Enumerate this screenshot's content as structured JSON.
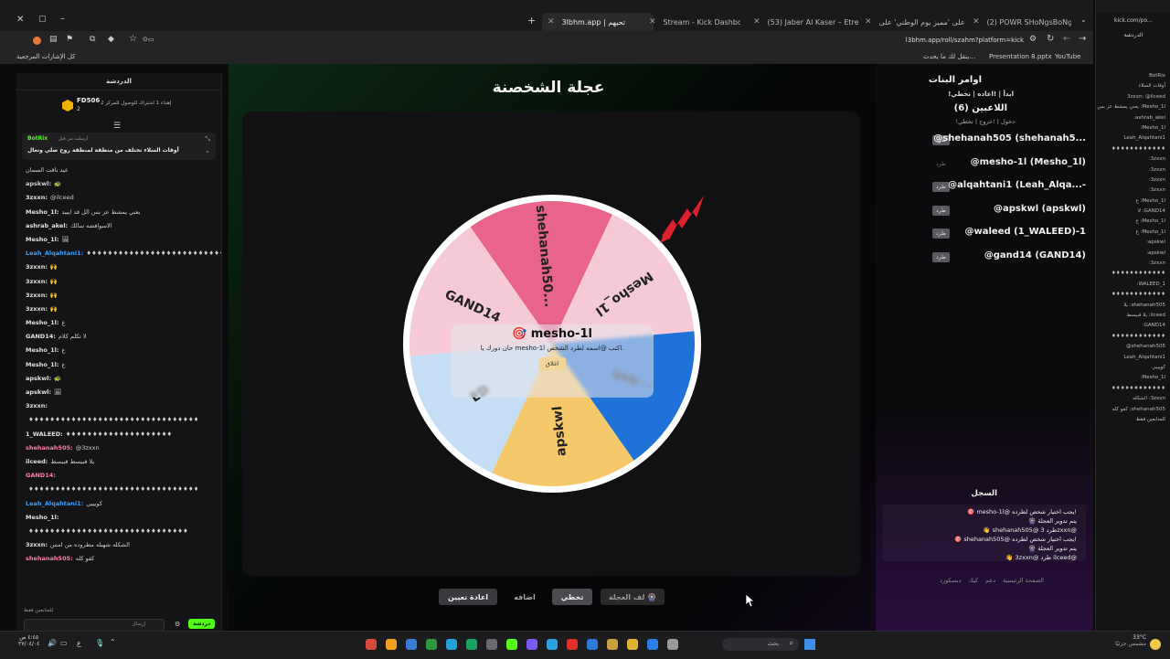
{
  "browser": {
    "tabs": [
      {
        "title": "ا3bhm.app | تحيهم",
        "active": true
      },
      {
        "title": "Stream - Kick Dashboard"
      },
      {
        "title": "(53) Jaber Al Kaser – Etreb Ya !"
      },
      {
        "title": "انظر على 'مميز يوم الوطني' على…"
      },
      {
        "title": "(2) POWR SHoNgsBoNg (@SH…"
      }
    ],
    "new_tab_symbol": "+",
    "address": "l3bhm.app/roll/szahm?platform=kick",
    "bookmarks": {
      "all_bookmarks": "كل الإشارات المرجعية",
      "youtube": "YouTube",
      "presentation": "Presentation 8.pptx",
      "x_item": "ينقل لك ما يحدث…"
    }
  },
  "left_chat": {
    "header": "الدردشة",
    "pinned_user": "FD506",
    "pinned_rank": "2",
    "pinned_note": "إهداء 1 اشتراك للوصول للمركز 2",
    "bot_name": "BotRix",
    "bot_pinned_by": "أرسلت من قبل",
    "bot_message": "أوقات السلاء تختلف من منطقة لمنطقة روح صلي وتعال",
    "messages": [
      {
        "user": "",
        "text": "عيد باقت السمان",
        "color": "#c9c9c9"
      },
      {
        "user": "apskwl:",
        "text": "🐢",
        "color": "#d0d0d0"
      },
      {
        "user": "3zxxn:",
        "text": "@ilceed",
        "color": "#e0e0e0"
      },
      {
        "user": "Mesho_1l:",
        "text": "يعني يمشط عز بس الل قد ايبيد",
        "color": "#e0e0e0"
      },
      {
        "user": "ashrab_akel:",
        "text": "الاسوافضه سالك",
        "color": "#e0e0e0"
      },
      {
        "user": "Mesho_1l:",
        "text": "🖼",
        "color": "#e0e0e0"
      },
      {
        "user": "Leah_Alqahtani1:",
        "text": "♦♦♦♦♦♦♦♦♦♦♦♦♦♦♦♦♦♦♦♦♦♦♦♦♦♦",
        "color": "#3aa0ff"
      },
      {
        "user": "3zxxn:",
        "text": "🙌",
        "color": "#e0e0e0"
      },
      {
        "user": "3zxxn:",
        "text": "🙌",
        "color": "#e0e0e0"
      },
      {
        "user": "3zxxn:",
        "text": "🙌",
        "color": "#e0e0e0"
      },
      {
        "user": "3zxxn:",
        "text": "🙌",
        "color": "#e0e0e0"
      },
      {
        "user": "Mesho_1l:",
        "text": "ع",
        "color": "#e0e0e0"
      },
      {
        "user": "GAND14:",
        "text": "لا تكلم كلام",
        "color": "#e0e0e0"
      },
      {
        "user": "Mesho_1l:",
        "text": "ع",
        "color": "#e0e0e0"
      },
      {
        "user": "Mesho_1l:",
        "text": "ع",
        "color": "#e0e0e0"
      },
      {
        "user": "apskwl:",
        "text": "🐢",
        "color": "#e0e0e0"
      },
      {
        "user": "apskwl:",
        "text": "🖼",
        "color": "#e0e0e0"
      },
      {
        "user": "3zxxn:",
        "text": "",
        "color": "#e0e0e0"
      },
      {
        "user": "",
        "text": "♦♦♦♦♦♦♦♦♦♦♦♦♦♦♦♦♦♦♦♦♦♦♦♦♦♦♦♦♦♦♦♦",
        "color": "#e0e0e0"
      },
      {
        "user": "1_WALEED:",
        "text": "♦♦♦♦♦♦♦♦♦♦♦♦♦♦♦♦♦♦♦♦",
        "color": "#e0e0e0"
      },
      {
        "user": "shehanah505:",
        "text": "@3zxxn",
        "color": "#ff7aa8"
      },
      {
        "user": "ilceed:",
        "text": "يلا قبيسط قبيسط",
        "color": "#e0e0e0"
      },
      {
        "user": "GAND14:",
        "text": "",
        "color": "#ff7aa8"
      },
      {
        "user": "",
        "text": "♦♦♦♦♦♦♦♦♦♦♦♦♦♦♦♦♦♦♦♦♦♦♦♦♦♦♦♦♦♦♦♦",
        "color": "#e0e0e0"
      },
      {
        "user": "Leah_Alqahtani1:",
        "text": "كويييي",
        "color": "#3aa0ff"
      },
      {
        "user": "Mesho_1l:",
        "text": "",
        "color": "#e0e0e0"
      },
      {
        "user": "",
        "text": "♦♦♦♦♦♦♦♦♦♦♦♦♦♦♦♦♦♦♦♦♦♦♦♦♦♦♦♦♦♦",
        "color": "#e0e0e0"
      },
      {
        "user": "3zxxn:",
        "text": "الشكله شهبله مطروده من امس",
        "color": "#e0e0e0"
      },
      {
        "user": "shehanah505:",
        "text": "كفو كله",
        "color": "#ff7aa8"
      }
    ],
    "followers_only": "للمتابعين فقط",
    "input_placeholder": "إرسال",
    "chat_button": "دردشة"
  },
  "main": {
    "title": "عجلة الشخصنة",
    "wheel_segments": [
      {
        "label": "shehanah50...",
        "color": "#e8648a"
      },
      {
        "label": "Mesho_1l",
        "color": "#f6c9d6"
      },
      {
        "label": "...qah",
        "color": "#1e72d8"
      },
      {
        "label": "apskwl",
        "color": "#f5c86a"
      },
      {
        "label": "ED",
        "color": "#c6def5"
      },
      {
        "label": "GAND14",
        "color": "#f6c9d6"
      }
    ],
    "popup": {
      "name": "🎯 mesho-1l",
      "message": "حان دورك يا mesho-1l اكتب @اسمه لطرد الشخص.",
      "close": "اغلاق"
    },
    "buttons": {
      "reset": "اعادة تعيين",
      "add": "اضافه",
      "skip": "تخطي",
      "spin": "لف العجلة 🎡"
    }
  },
  "commands": {
    "title": "اوامر البنات",
    "cmd_line": "!ابدأ | !اعاده | تخطي",
    "players_title": "اللاعبين (6)",
    "join_line": "!دخول | !خروج | تخطي",
    "kick_label": "طرد",
    "players": [
      {
        "name": "@shehanah505 (shehanah5...",
        "kick_active": true
      },
      {
        "name": "@mesho-1l (Mesho_1l)",
        "kick_active": false
      },
      {
        "name": "@alqahtani1 (Leah_Alqa...-",
        "kick_active": true
      },
      {
        "name": "@apskwl (apskwl)",
        "kick_active": true
      },
      {
        "name": "@waleed (1_WALEED)-1",
        "kick_active": true
      },
      {
        "name": "@gand14 (GAND14)",
        "kick_active": true
      }
    ],
    "log_title": "السجل",
    "log": [
      "🎯 mesho-1l@ يجب اختيار شخص لطرده!",
      "🎡 يتم تدوير العجلة",
      "👋 shehanah505@ طرد 3zxxn@",
      "🎯 shehanah505@ يجب اختيار شخص لطرده!",
      "🎡 يتم تدوير العجلة",
      "👋 3zxxn@ طرد ilceed@"
    ],
    "footer_links": [
      "الصفحة الرئيسية",
      "دعم",
      "كيك",
      "ديسكورد"
    ]
  },
  "right_panel": {
    "url": "kick.com/po...",
    "header": "الدردشة",
    "rows": [
      "BotRix",
      "أوقات السلاء",
      "3zxxn: @ilceed",
      "Mesho_1l: يعني يمشط عز بس",
      "ashrab_akel:",
      "Mesho_1l:",
      "Leah_Alqahtani1",
      "♦♦♦♦♦♦♦♦♦♦♦♦",
      "3zxxn:",
      "3zxxn:",
      "3zxxn:",
      "3zxxn:",
      "Mesho_1l: ع",
      "GAND14: لا",
      "Mesho_1l: ع",
      "Mesho_1l: ع",
      "apskwl:",
      "apskwl:",
      "3zxxn:",
      "♦♦♦♦♦♦♦♦♦♦♦♦",
      "1_WALEED:",
      "♦♦♦♦♦♦♦♦♦♦♦♦",
      "shehanah505: يلا",
      "ilceed: يلا قبيسط",
      "GAND14:",
      "♦♦♦♦♦♦♦♦♦♦♦♦",
      "shehanah505@",
      "Leah_Alqahtani1",
      "كويييي",
      "Mesho_1l:",
      "♦♦♦♦♦♦♦♦♦♦♦♦",
      "3zxxn: الشكله",
      "shehanah505: كفو كله",
      "للمتابعين فقط"
    ]
  },
  "taskbar": {
    "search_placeholder": "بحث",
    "weather": "33°C",
    "weather_desc": "مشمس جزئيًا",
    "time": "٤:٤٥ ص",
    "date": "٢٧/٠٤/٠٤"
  }
}
